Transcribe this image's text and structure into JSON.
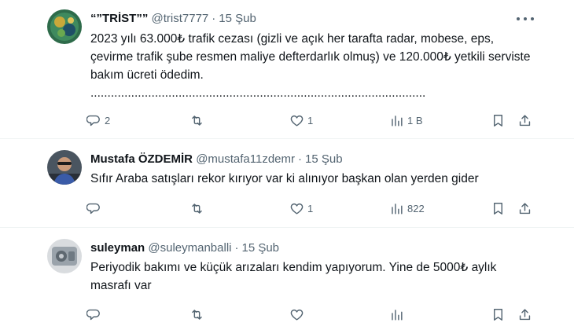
{
  "colors": {
    "text": "#0f1419",
    "secondary": "#536471",
    "divider": "#eff3f4"
  },
  "tweets": [
    {
      "name": "“”TRİST”” ",
      "handle": "@trist7777",
      "date": "15 Şub",
      "text": "2023 yılı 63.000₺ trafik cezası (gizli ve açık her tarafta radar, mobese, eps, çevirme trafik şube resmen maliye defterdarlık olmuş) ve 120.000₺ yetkili serviste bakım ücreti ödedim.\n...................................................................................................",
      "replies": "2",
      "retweets": "",
      "likes": "1",
      "views": "1 B"
    },
    {
      "name": "Mustafa ÖZDEMİR",
      "handle": "@mustafa11zdemr",
      "date": "15 Şub",
      "text": "Sıfır Araba satışları rekor kırıyor var ki alınıyor başkan olan yerden gider",
      "replies": "",
      "retweets": "",
      "likes": "1",
      "views": "822"
    },
    {
      "name": "suleyman",
      "handle": "@suleymanballi",
      "date": "15 Şub",
      "text": "Periyodik bakımı ve küçük arızaları kendim yapıyorum. Yine de 5000₺ aylık masrafı var",
      "replies": "",
      "retweets": "",
      "likes": "",
      "views": ""
    }
  ]
}
